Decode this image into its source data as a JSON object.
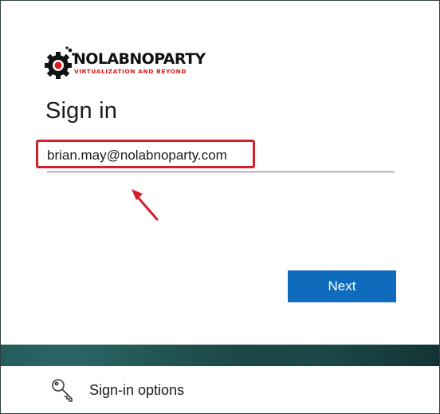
{
  "brand": {
    "name": "NOLABNOPARTY",
    "tagline": "VIRTUALIZATION AND BEYOND"
  },
  "signin": {
    "title": "Sign in",
    "email_value": "brian.may@nolabnoparty.com",
    "next_label": "Next"
  },
  "footer": {
    "options_label": "Sign-in options"
  },
  "colors": {
    "primary_button": "#0f6cbd",
    "highlight_box": "#d21f2b",
    "brand_red": "#e01818"
  },
  "icons": {
    "logo": "gear-logo-icon",
    "annotation": "red-arrow-icon",
    "options": "key-icon"
  }
}
